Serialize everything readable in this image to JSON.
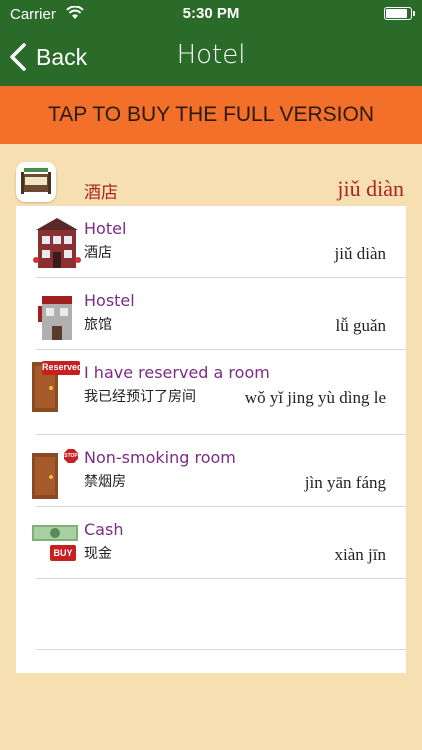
{
  "status_bar": {
    "carrier": "Carrier",
    "time": "5:30 PM",
    "battery_level": 0.95
  },
  "nav": {
    "back_label": "Back",
    "title": "Hotel"
  },
  "banner": {
    "text": "TAP TO BUY THE FULL VERSION"
  },
  "category": {
    "chinese": "酒店",
    "pinyin": "jiǔ diàn"
  },
  "phrases": [
    {
      "english": "Hotel",
      "chinese": "酒店",
      "pinyin": "jiǔ diàn",
      "icon": "hotel-building-icon"
    },
    {
      "english": "Hostel",
      "chinese": "旅馆",
      "pinyin": "lǚ guǎn",
      "icon": "hostel-building-icon"
    },
    {
      "english": "I have reserved a room",
      "chinese": "我已经预订了房间",
      "pinyin": "wǒ yǐ jing yù dìng le",
      "icon": "reserved-door-icon",
      "badge": "Reserved"
    },
    {
      "english": "Non-smoking room",
      "chinese": "禁烟房",
      "pinyin": "jìn yān fáng",
      "icon": "no-smoking-door-icon",
      "badge": "STOP"
    },
    {
      "english": "Cash",
      "chinese": "现金",
      "pinyin": "xiàn jīn",
      "icon": "cash-icon",
      "badge": "BUY"
    }
  ],
  "colors": {
    "nav_green": "#2a6b2a",
    "banner_orange": "#f27029",
    "background": "#f6dfb1",
    "english_purple": "#7b2c84",
    "category_red": "#a9251f"
  }
}
